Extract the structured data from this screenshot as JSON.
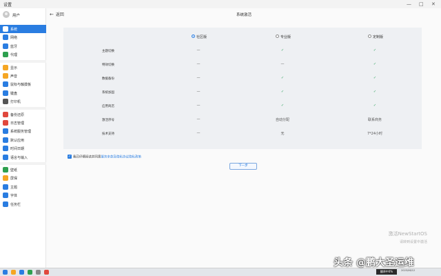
{
  "window": {
    "title": "设置",
    "minimize": "—",
    "maximize": "□",
    "close": "✕"
  },
  "sidebar": {
    "user": "用户",
    "groups": [
      [
        {
          "label": "系统",
          "color": "#2a7de1",
          "active": true
        },
        {
          "label": "网络",
          "color": "#2a7de1"
        },
        {
          "label": "蓝牙",
          "color": "#2a7de1"
        },
        {
          "label": "代理",
          "color": "#2ea04f"
        }
      ],
      [
        {
          "label": "显示",
          "color": "#f5a623"
        },
        {
          "label": "声音",
          "color": "#f5a623"
        },
        {
          "label": "鼠标与触摸板",
          "color": "#2a7de1"
        },
        {
          "label": "键盘",
          "color": "#2a7de1"
        },
        {
          "label": "打印机",
          "color": "#555555"
        }
      ],
      [
        {
          "label": "备份还原",
          "color": "#e0483d"
        },
        {
          "label": "日志管理",
          "color": "#e0483d"
        },
        {
          "label": "系统服务管理",
          "color": "#2a7de1"
        },
        {
          "label": "默认应用",
          "color": "#2a7de1"
        },
        {
          "label": "时间日期",
          "color": "#2a7de1"
        },
        {
          "label": "语言与输入",
          "color": "#2a7de1"
        }
      ],
      [
        {
          "label": "壁纸",
          "color": "#2ea04f"
        },
        {
          "label": "屏保",
          "color": "#f5a623"
        },
        {
          "label": "主题",
          "color": "#2a7de1"
        },
        {
          "label": "字体",
          "color": "#2a7de1"
        },
        {
          "label": "任务栏",
          "color": "#2a7de1"
        }
      ]
    ]
  },
  "main": {
    "back": "返回",
    "title": "系统激活",
    "editions": [
      "社区版",
      "专业版",
      "定制版"
    ],
    "selected_edition": 0,
    "rows": [
      {
        "label": "主题切换",
        "values": [
          "—",
          "✓",
          "✓"
        ]
      },
      {
        "label": "特效切换",
        "values": [
          "—",
          "—",
          "✓"
        ]
      },
      {
        "label": "数据备份",
        "values": [
          "—",
          "✓",
          "✓"
        ]
      },
      {
        "label": "系统加固",
        "values": [
          "—",
          "✓",
          "✓"
        ]
      },
      {
        "label": "应用商店",
        "values": [
          "—",
          "✓",
          "✓"
        ]
      },
      {
        "label": "激活序号",
        "values": [
          "—",
          "自动分配",
          "联系商务"
        ]
      },
      {
        "label": "技术支持",
        "values": [
          "—",
          "无",
          "7*24小时"
        ]
      }
    ],
    "agree_prefix": "我已仔细阅读并同意",
    "agree_link": "服务条款及隐私协议",
    "agree_suffix": "隐私政策",
    "next": "下一步"
  },
  "watermark_activate": {
    "line1": "激活NewStartOS",
    "line2": "请转到设置中激活"
  },
  "taskbar": {
    "tray_label": "翻译中0%",
    "clock_time": "",
    "clock_date": "2025/06/12"
  },
  "overlay_watermark": "头条 @鹏大圣运维"
}
